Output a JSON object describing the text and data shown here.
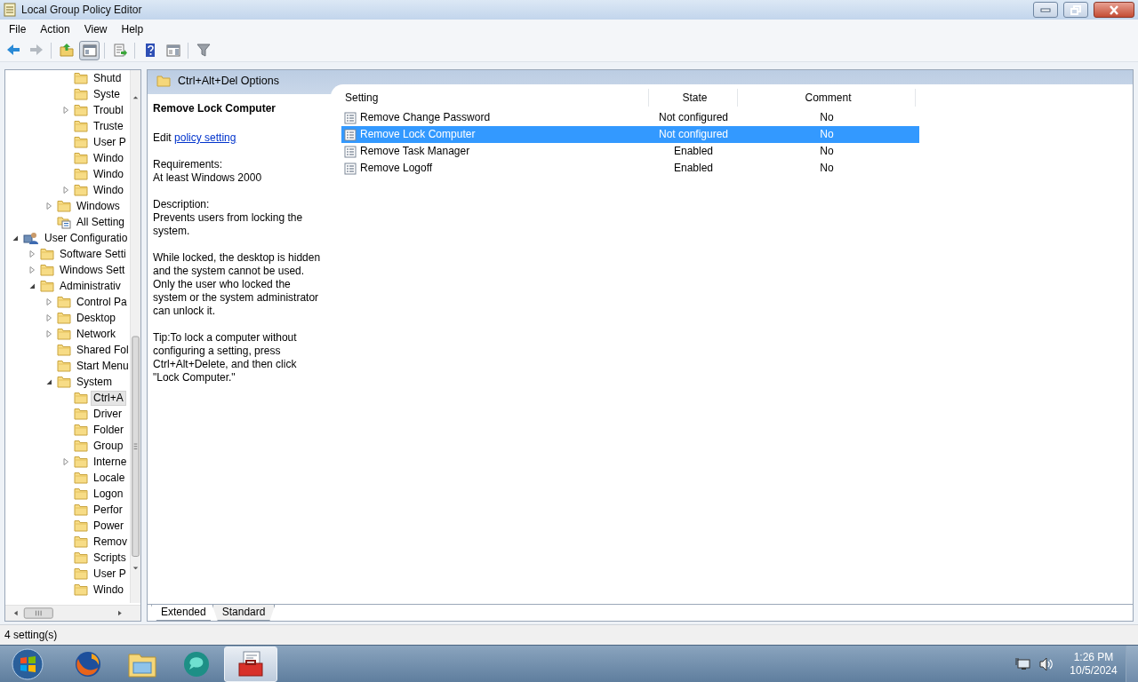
{
  "window": {
    "title": "Local Group Policy Editor"
  },
  "menu": [
    "File",
    "Action",
    "View",
    "Help"
  ],
  "toolbar": [
    {
      "kind": "back",
      "disabled": false
    },
    {
      "kind": "forward",
      "disabled": true
    },
    {
      "kind": "separator"
    },
    {
      "kind": "up",
      "disabled": false
    },
    {
      "kind": "tree",
      "disabled": false,
      "pressed": true
    },
    {
      "kind": "separator"
    },
    {
      "kind": "export",
      "disabled": false
    },
    {
      "kind": "separator"
    },
    {
      "kind": "help",
      "disabled": false
    },
    {
      "kind": "actions",
      "disabled": false
    },
    {
      "kind": "separator"
    },
    {
      "kind": "filter",
      "disabled": false
    }
  ],
  "tree": {
    "items": [
      {
        "children": [
          {
            "children": [
              {
                "children": [
                  {
                    "label": "Shutd",
                    "kind": "folder",
                    "selected": false
                  },
                  {
                    "label": "Syste",
                    "kind": "folder",
                    "selected": false
                  },
                  {
                    "label": "Troubl",
                    "kind": "folder",
                    "expandable": true,
                    "expanded": false,
                    "selected": false
                  },
                  {
                    "label": "Truste",
                    "kind": "folder",
                    "selected": false
                  },
                  {
                    "label": "User P",
                    "kind": "folder",
                    "selected": false
                  },
                  {
                    "label": "Windo",
                    "kind": "folder",
                    "selected": false
                  },
                  {
                    "label": "Windo",
                    "kind": "folder",
                    "selected": false
                  },
                  {
                    "label": "Windo",
                    "kind": "folder",
                    "expandable": true,
                    "expanded": false,
                    "selected": false
                  }
                ]
              },
              {
                "label": "Windows",
                "kind": "folder",
                "expandable": true,
                "expanded": false,
                "selected": false
              },
              {
                "label": "All Setting",
                "kind": "settings",
                "selected": false
              }
            ]
          }
        ]
      },
      {
        "label": "User Configuratio",
        "kind": "user",
        "expandable": true,
        "expanded": true,
        "selected": false,
        "children": [
          {
            "label": "Software Setti",
            "kind": "folder",
            "expandable": true,
            "expanded": false,
            "selected": false
          },
          {
            "label": "Windows Sett",
            "kind": "folder",
            "expandable": true,
            "expanded": false,
            "selected": false
          },
          {
            "label": "Administrativ",
            "kind": "folder",
            "expandable": true,
            "expanded": true,
            "selected": false,
            "children": [
              {
                "label": "Control Pa",
                "kind": "folder",
                "expandable": true,
                "expanded": false,
                "selected": false
              },
              {
                "label": "Desktop",
                "kind": "folder",
                "expandable": true,
                "expanded": false,
                "selected": false
              },
              {
                "label": "Network",
                "kind": "folder",
                "expandable": true,
                "expanded": false,
                "selected": false
              },
              {
                "label": "Shared Fol",
                "kind": "folder",
                "selected": false
              },
              {
                "label": "Start Menu",
                "kind": "folder",
                "selected": false
              },
              {
                "label": "System",
                "kind": "folder",
                "expandable": true,
                "expanded": true,
                "selected": false,
                "children": [
                  {
                    "label": "Ctrl+A",
                    "kind": "folder",
                    "selected": true
                  },
                  {
                    "label": "Driver",
                    "kind": "folder",
                    "selected": false
                  },
                  {
                    "label": "Folder",
                    "kind": "folder",
                    "selected": false
                  },
                  {
                    "label": "Group",
                    "kind": "folder",
                    "selected": false
                  },
                  {
                    "label": "Interne",
                    "kind": "folder",
                    "expandable": true,
                    "expanded": false,
                    "selected": false
                  },
                  {
                    "label": "Locale",
                    "kind": "folder",
                    "selected": false
                  },
                  {
                    "label": "Logon",
                    "kind": "folder",
                    "selected": false
                  },
                  {
                    "label": "Perfor",
                    "kind": "folder",
                    "selected": false
                  },
                  {
                    "label": "Power",
                    "kind": "folder",
                    "selected": false
                  },
                  {
                    "label": "Remov",
                    "kind": "folder",
                    "selected": false
                  },
                  {
                    "label": "Scripts",
                    "kind": "folder",
                    "selected": false
                  },
                  {
                    "label": "User P",
                    "kind": "folder",
                    "selected": false
                  },
                  {
                    "label": "Windo",
                    "kind": "folder",
                    "selected": false
                  }
                ]
              }
            ]
          }
        ]
      }
    ]
  },
  "details": {
    "header": "Ctrl+Alt+Del Options",
    "title": "Remove Lock Computer",
    "edit_prefix": "Edit",
    "edit_link": "policy setting",
    "sections": [
      {
        "heading": "Requirements:",
        "text": "At least Windows 2000"
      },
      {
        "heading": "Description:",
        "text": "Prevents users from locking the system."
      }
    ],
    "paragraphs": [
      "While locked, the desktop is hidden and the system cannot be used. Only the user who locked the system or the system administrator can unlock it.",
      "Tip:To lock a computer without configuring a setting, press Ctrl+Alt+Delete, and then click \"Lock Computer.\""
    ]
  },
  "table": {
    "columns": [
      "Setting",
      "State",
      "Comment"
    ],
    "rows": [
      {
        "setting": "Remove Change Password",
        "state": "Not configured",
        "comment": "No",
        "selected": false
      },
      {
        "setting": "Remove Lock Computer",
        "state": "Not configured",
        "comment": "No",
        "selected": true
      },
      {
        "setting": "Remove Task Manager",
        "state": "Enabled",
        "comment": "No",
        "selected": false
      },
      {
        "setting": "Remove Logoff",
        "state": "Enabled",
        "comment": "No",
        "selected": false
      }
    ]
  },
  "view_tabs": [
    {
      "label": "Extended",
      "selected": true
    },
    {
      "label": "Standard",
      "selected": false
    }
  ],
  "status_bar": "4 setting(s)",
  "taskbar": {
    "apps": [
      {
        "kind": "start",
        "active": false
      },
      {
        "kind": "firefox",
        "active": false
      },
      {
        "kind": "explorer",
        "active": false
      },
      {
        "kind": "chat",
        "active": false
      },
      {
        "kind": "gpedit",
        "active": true
      }
    ],
    "clock": {
      "time": "1:26 PM",
      "date": "10/5/2024"
    }
  }
}
